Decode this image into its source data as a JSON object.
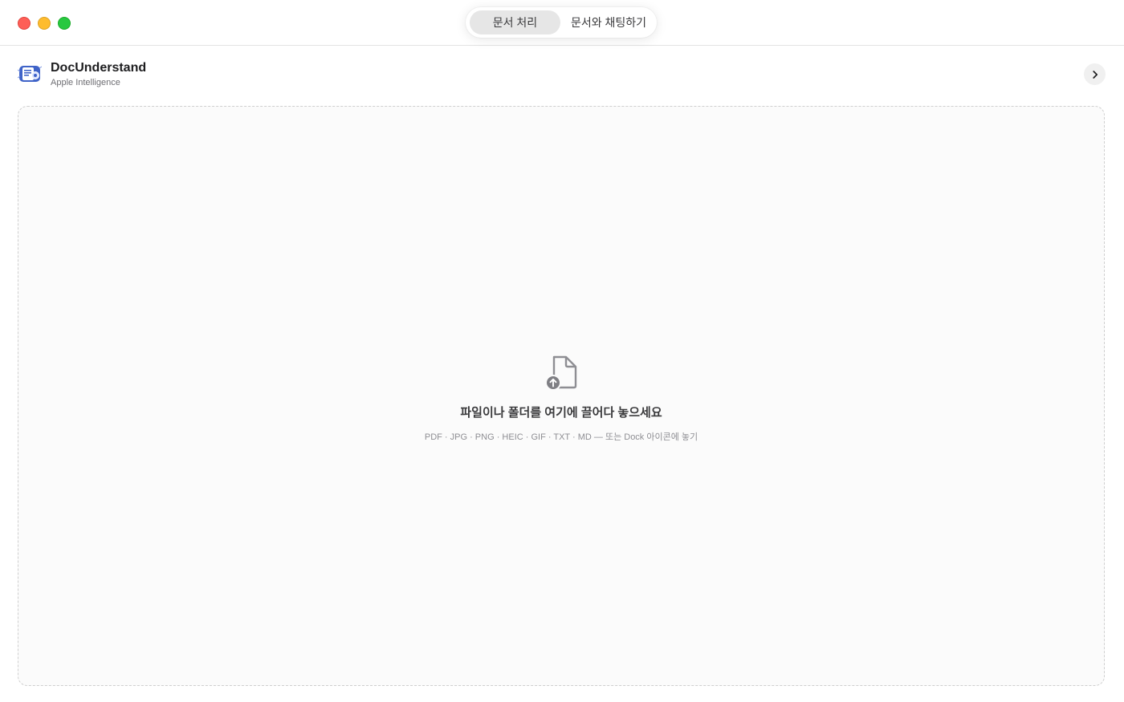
{
  "titlebar": {
    "tabs": [
      {
        "label": "문서 처리",
        "selected": true
      },
      {
        "label": "문서와 채팅하기",
        "selected": false
      }
    ]
  },
  "header": {
    "app_name": "DocUnderstand",
    "app_subtitle": "Apple Intelligence",
    "app_icon": "docunderstand-app-icon",
    "expand_icon": "chevron-right-icon"
  },
  "dropzone": {
    "icon": "document-upload-icon",
    "title": "파일이나 폴더를 여기에 끌어다 놓으세요",
    "formats": "PDF · JPG · PNG · HEIC · GIF · TXT · MD — 또는 Dock 아이콘에 놓기"
  },
  "colors": {
    "close": "#fe5f57",
    "minimize": "#febc2e",
    "zoom": "#28c840",
    "selected_tab_bg": "#e6e6e6",
    "dropzone_border": "#cfcfcf"
  }
}
